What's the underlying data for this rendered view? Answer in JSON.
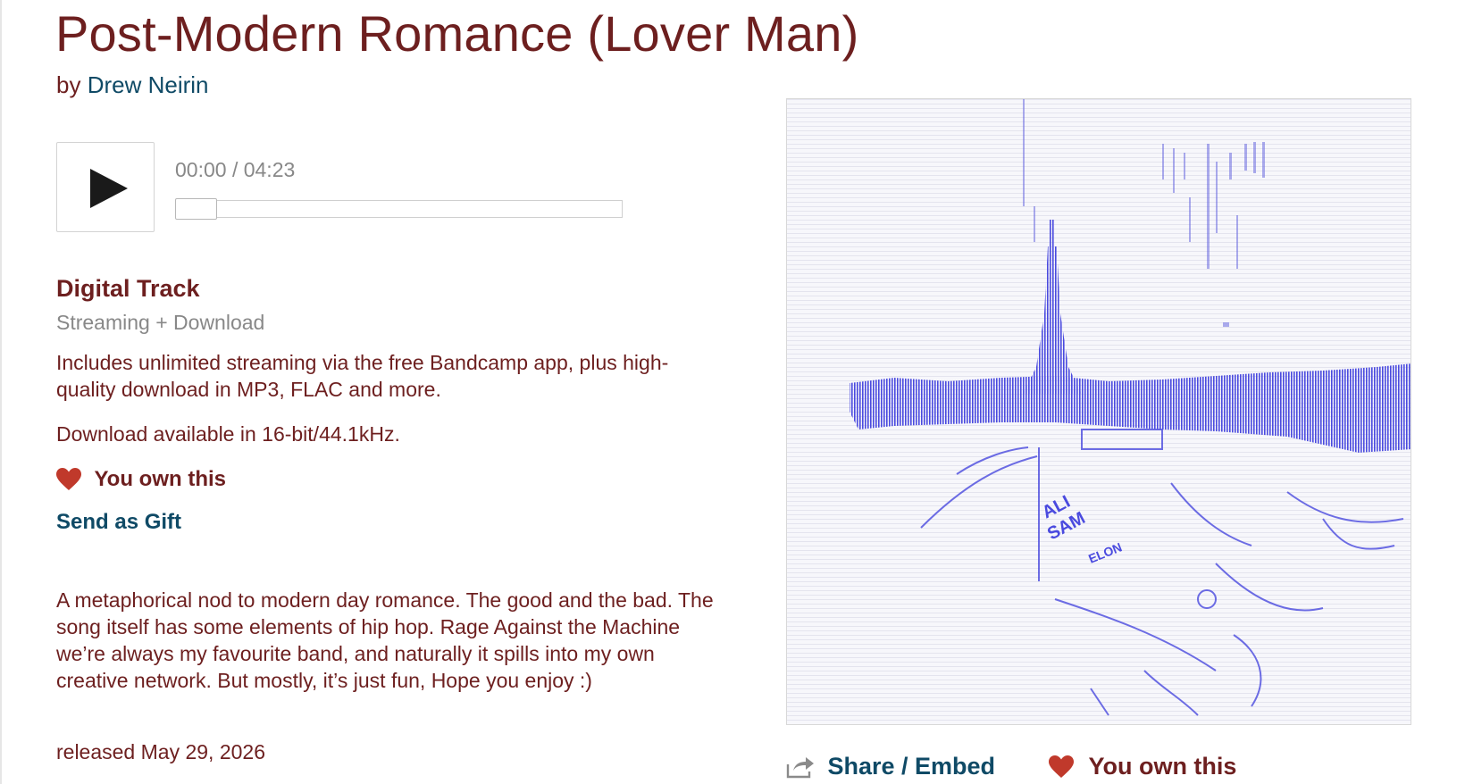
{
  "track": {
    "title": "Post-Modern Romance (Lover Man)",
    "by_prefix": "by",
    "artist": "Drew Neirin"
  },
  "player": {
    "time": "00:00 / 04:23",
    "progress_fraction": 0
  },
  "purchase": {
    "heading": "Digital Track",
    "subheading": "Streaming + Download",
    "includes": "Includes unlimited streaming via the free Bandcamp app, plus high-quality download in MP3, FLAC and more.",
    "format": "Download available in 16-bit/44.1kHz.",
    "own_label": "You own this",
    "gift_label": "Send as Gift"
  },
  "description": "A metaphorical nod to modern day romance. The good and the bad. The song itself has some elements of hip hop. Rage Against the Machine we’re always my favourite band, and naturally it spills into my own creative network. But mostly, it’s just fun, Hope you enjoy :)",
  "released": "released May 29, 2026",
  "artwork": {
    "graffiti_1": "ALI",
    "graffiti_2": "SAM",
    "graffiti_3": "ELON"
  },
  "actions": {
    "share_label": "Share / Embed",
    "own_label": "You own this"
  },
  "colors": {
    "title": "#6d1f1f",
    "link": "#0f4a66",
    "heart": "#c0392b",
    "muted": "#888888",
    "artwork_ink": "#4a4adf"
  },
  "icons": {
    "play": "play-icon",
    "heart": "heart-icon",
    "share": "share-icon"
  }
}
